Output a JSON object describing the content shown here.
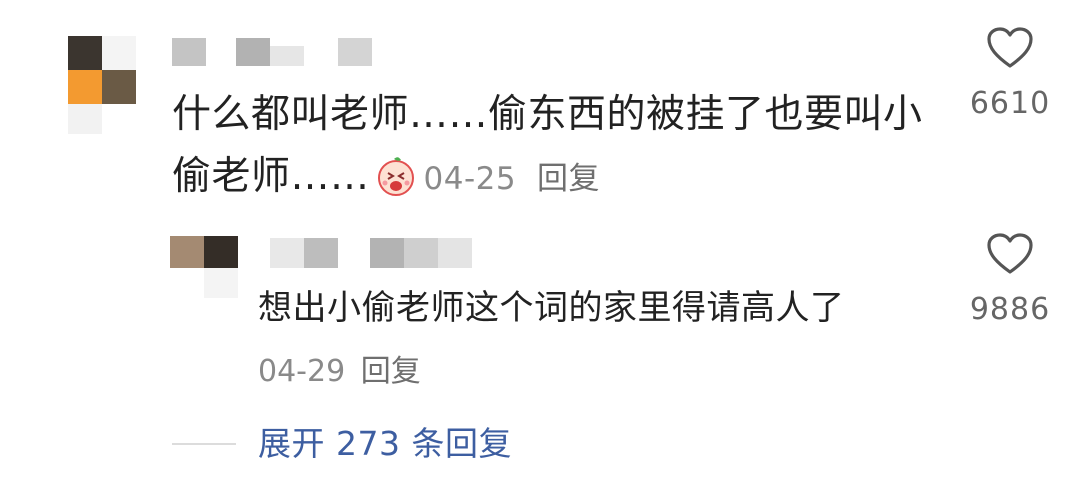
{
  "comment": {
    "text": "什么都叫老师……偷东西的被挂了也要叫小偷老师……",
    "date": "04-25",
    "reply_label": "回复",
    "like_count": "6610",
    "emoji_icon": "crying-face-emoji-icon"
  },
  "reply": {
    "text": "想出小偷老师这个词的家里得请高人了",
    "date": "04-29",
    "reply_label": "回复",
    "like_count": "9886"
  },
  "expand": {
    "label": "展开 273 条回复"
  },
  "colors": {
    "text": "#222222",
    "meta": "#8a8a8a",
    "link": "#3d5ea1"
  }
}
